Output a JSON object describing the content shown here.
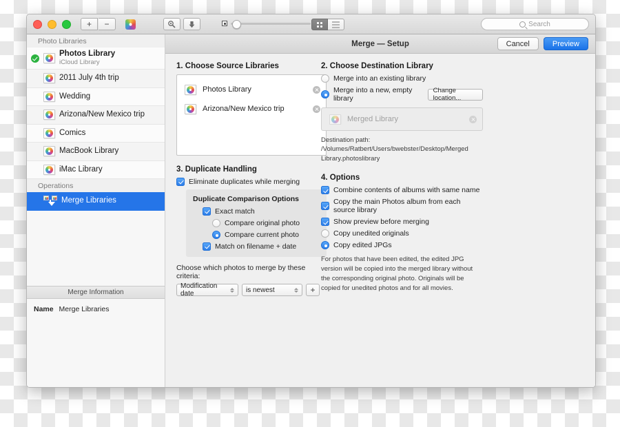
{
  "toolbar": {
    "buttons": [
      {
        "name": "add-library-button",
        "label": "+"
      },
      {
        "name": "remove-library-button",
        "label": "−"
      }
    ],
    "photos_app_icon": "photos-icon",
    "tools": [
      {
        "name": "inspect-library-button",
        "icon": "magnifier-key-icon"
      },
      {
        "name": "import-library-button",
        "icon": "download-arrow-icon"
      }
    ],
    "zoom_slider": {
      "name": "thumbnail-size-slider",
      "min_icon": "small-thumbnail-icon",
      "max_icon": "large-thumbnail-icon",
      "value": 3
    },
    "view_toggle": {
      "grid": "grid-view-icon",
      "list": "list-view-icon",
      "active": "grid"
    },
    "search": {
      "placeholder": "Search",
      "value": ""
    }
  },
  "sidebar": {
    "section_photo_libraries": "Photo Libraries",
    "libraries": [
      {
        "name": "Photos Library",
        "subtitle": "iCloud Library",
        "selected_badge": true,
        "bold": true
      },
      {
        "name": "2011 July 4th trip",
        "subtitle": "",
        "selected_badge": false,
        "bold": false
      },
      {
        "name": "Wedding",
        "subtitle": "",
        "selected_badge": false,
        "bold": false
      },
      {
        "name": "Arizona/New Mexico trip",
        "subtitle": "",
        "selected_badge": false,
        "bold": false
      },
      {
        "name": "Comics",
        "subtitle": "",
        "selected_badge": false,
        "bold": false
      },
      {
        "name": "MacBook Library",
        "subtitle": "",
        "selected_badge": false,
        "bold": false
      },
      {
        "name": "iMac Library",
        "subtitle": "",
        "selected_badge": false,
        "bold": false
      }
    ],
    "section_operations": "Operations",
    "operations": [
      {
        "name": "Merge Libraries",
        "selected": true
      }
    ],
    "info_header": "Merge Information",
    "info_rows": [
      {
        "key": "Name",
        "value": "Merge Libraries"
      }
    ]
  },
  "sheet": {
    "title": "Merge — Setup",
    "cancel_label": "Cancel",
    "preview_label": "Preview",
    "accent_color": "#1a72e8"
  },
  "step1": {
    "title": "1. Choose Source Libraries",
    "items": [
      {
        "label": "Photos Library"
      },
      {
        "label": "Arizona/New Mexico trip"
      }
    ]
  },
  "step2": {
    "title": "2. Choose Destination Library",
    "radio_existing": "Merge into an existing library",
    "radio_new": "Merge into a new, empty library",
    "selected": "new",
    "change_location_label": "Change location...",
    "destination_name": "Merged Library",
    "destination_path": "Destination path: /Volumes/Ratbert/Users/bwebster/Desktop/Merged Library.photoslibrary"
  },
  "step3": {
    "title": "3. Duplicate Handling",
    "eliminate_duplicates": {
      "label": "Eliminate duplicates while merging",
      "checked": true
    },
    "comparison_title": "Duplicate Comparison Options",
    "exact_match": {
      "label": "Exact match",
      "checked": true
    },
    "compare_original": {
      "label": "Compare original photo",
      "selected": false
    },
    "compare_current": {
      "label": "Compare current photo",
      "selected": true
    },
    "match_filename_date": {
      "label": "Match on filename + date",
      "checked": true
    },
    "criteria_label": "Choose which photos to merge by these criteria:",
    "criteria_field": "Modification date",
    "criteria_operator": "is newest",
    "add_criteria_label": "+"
  },
  "step4": {
    "title": "4. Options",
    "checkboxes": [
      {
        "label": "Combine contents of albums with same name",
        "checked": true
      },
      {
        "label": "Copy the main Photos album from each source library",
        "checked": true
      },
      {
        "label": "Show preview before merging",
        "checked": true
      }
    ],
    "radio_unedited": {
      "label": "Copy unedited originals",
      "selected": false
    },
    "radio_edited": {
      "label": "Copy edited JPGs",
      "selected": true
    },
    "help_text": "For photos that have been edited, the edited JPG version will be copied into the merged library without the corresponding original photo. Originals will be copied for unedited photos and for all movies."
  }
}
